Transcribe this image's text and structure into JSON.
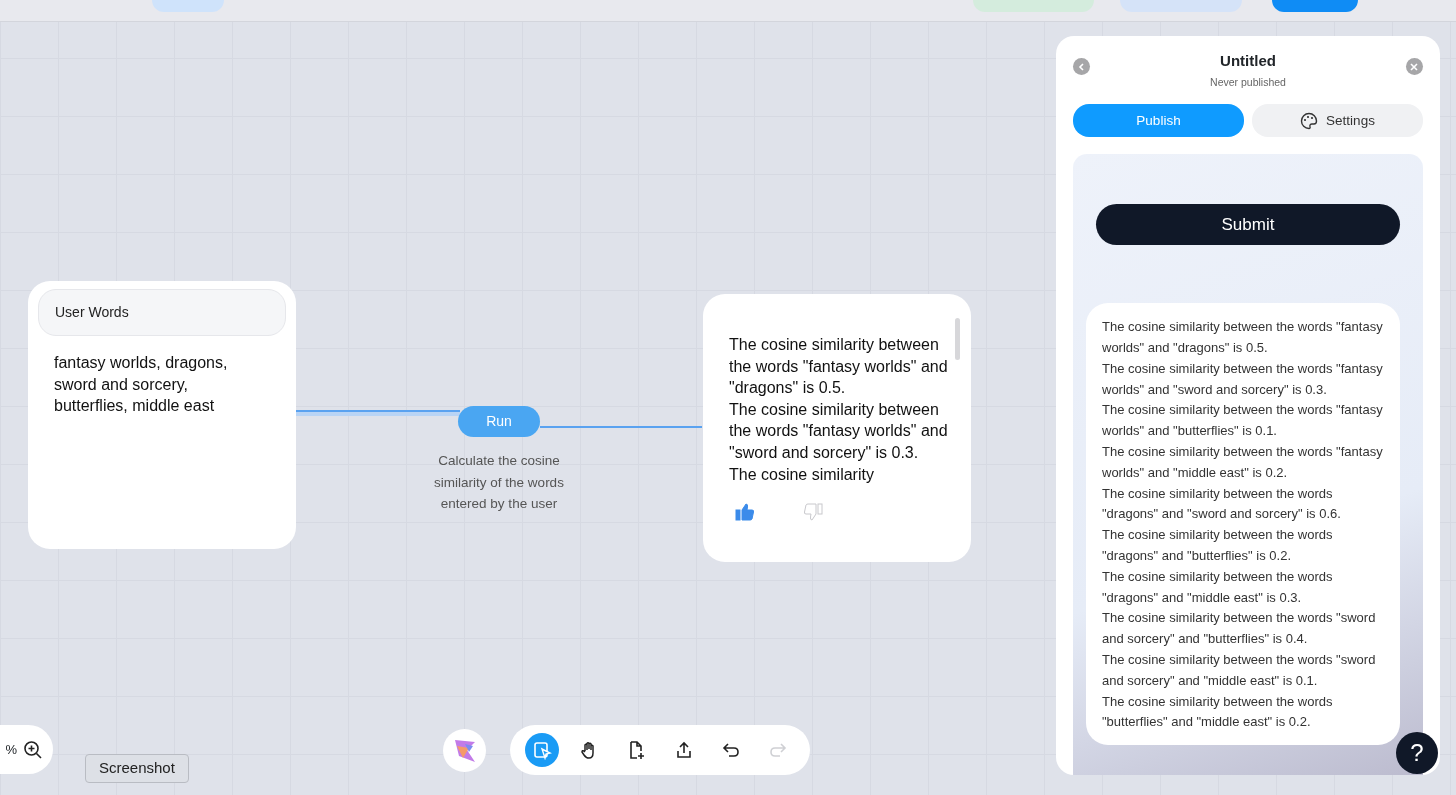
{
  "input_node": {
    "title": "User Words",
    "value": "fantasy worlds, dragons,\nsword and sorcery,\nbutterflies, middle east"
  },
  "run_node": {
    "button": "Run",
    "description": "Calculate the cosine similarity of the words entered by the user"
  },
  "output_node": {
    "text": "The cosine similarity between the words \"fantasy worlds\" and \"dragons\" is 0.5.\nThe cosine similarity between the words \"fantasy worlds\" and \"sword and sorcery\" is 0.3.\nThe cosine similarity",
    "feedback": [
      {
        "kind": "up",
        "selected": true
      },
      {
        "kind": "down",
        "selected": false
      }
    ]
  },
  "panel": {
    "title": "Untitled",
    "subtitle": "Never published",
    "tabs": [
      {
        "label": "Publish",
        "selected": true
      },
      {
        "label": "Settings",
        "selected": false
      }
    ],
    "submit": "Submit",
    "results": [
      "The cosine similarity between the words \"fantasy worlds\" and \"dragons\" is 0.5.",
      "The cosine similarity between the words \"fantasy worlds\" and \"sword and sorcery\" is 0.3.",
      "The cosine similarity between the words \"fantasy worlds\" and \"butterflies\" is 0.1.",
      "The cosine similarity between the words \"fantasy worlds\" and \"middle east\" is 0.2.",
      "The cosine similarity between the words \"dragons\" and \"sword and sorcery\" is 0.6.",
      "The cosine similarity between the words \"dragons\" and \"butterflies\" is 0.2.",
      "The cosine similarity between the words \"dragons\" and \"middle east\" is 0.3.",
      "The cosine similarity between the words \"sword and sorcery\" and \"butterflies\" is 0.4.",
      "The cosine similarity between the words \"sword and sorcery\" and \"middle east\" is 0.1.",
      "The cosine similarity between the words \"butterflies\" and \"middle east\" is 0.2."
    ],
    "help": "?"
  },
  "zoom": {
    "percent": "%"
  },
  "tooltip": "Screenshot",
  "toolbar": [
    {
      "kind": "select",
      "selected": true,
      "disabled": false
    },
    {
      "kind": "hand",
      "selected": false,
      "disabled": false
    },
    {
      "kind": "add-page",
      "selected": false,
      "disabled": false
    },
    {
      "kind": "share",
      "selected": false,
      "disabled": false
    },
    {
      "kind": "undo",
      "selected": false,
      "disabled": false
    },
    {
      "kind": "redo",
      "selected": false,
      "disabled": true
    }
  ]
}
